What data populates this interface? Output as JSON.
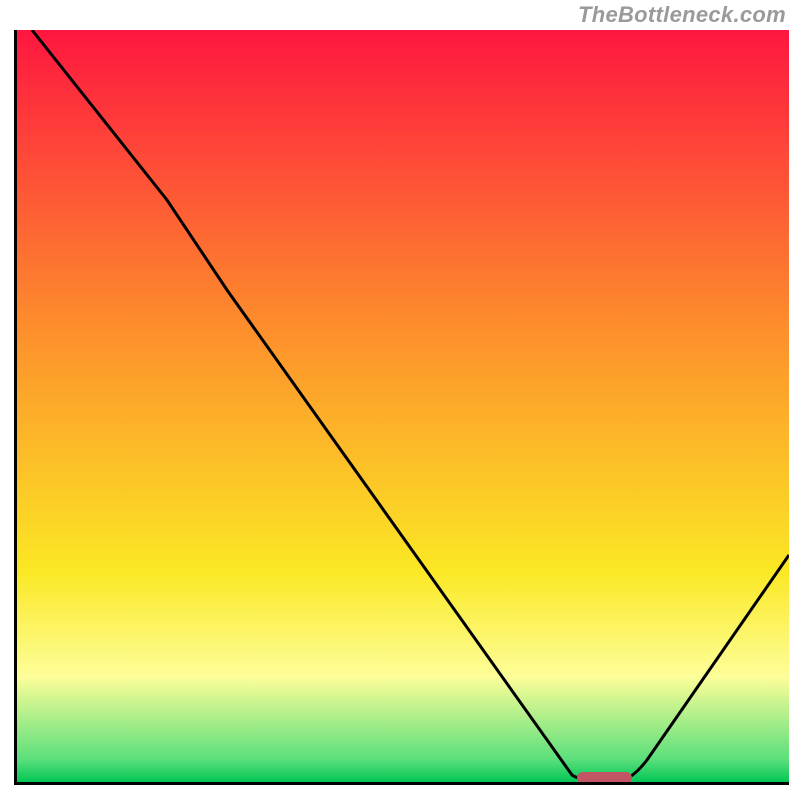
{
  "watermark": "TheBottleneck.com",
  "chart_data": {
    "type": "line",
    "title": "",
    "xlabel": "",
    "ylabel": "",
    "x": [
      0.02,
      0.23,
      0.72,
      0.76,
      0.78,
      1.0
    ],
    "y": [
      1.0,
      0.7,
      0.01,
      0.0,
      0.0,
      0.3
    ],
    "marker": {
      "x_range": [
        0.73,
        0.8
      ],
      "y": 0.005
    },
    "ylim": [
      0,
      1
    ],
    "xlim": [
      0,
      1
    ],
    "background": "vertical-gradient red→orange→yellow→green",
    "gradient_stops": [
      {
        "pos": 0.0,
        "color": "#fe1640"
      },
      {
        "pos": 0.4,
        "color": "#fd8f2c"
      },
      {
        "pos": 0.72,
        "color": "#fbe824"
      },
      {
        "pos": 0.86,
        "color": "#fdfe99"
      },
      {
        "pos": 0.97,
        "color": "#5bdf7b"
      },
      {
        "pos": 1.0,
        "color": "#02c655"
      }
    ]
  }
}
